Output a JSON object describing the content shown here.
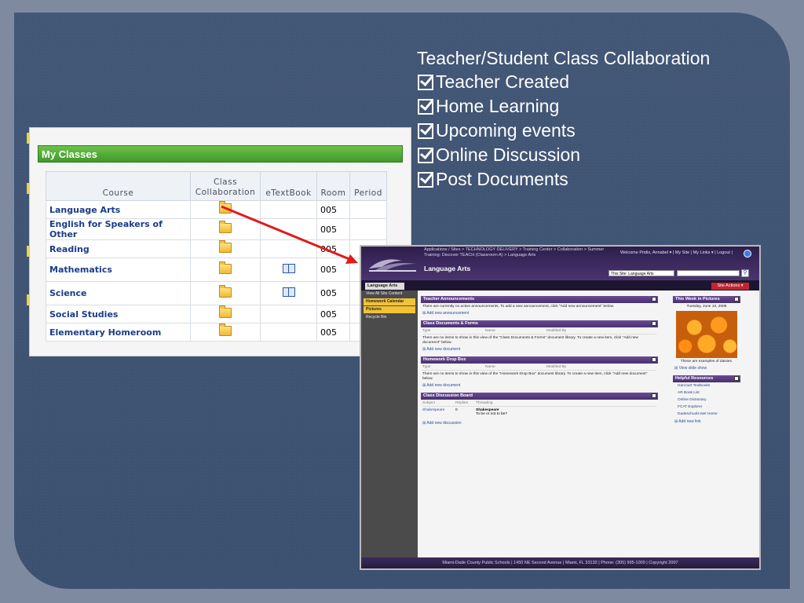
{
  "features": {
    "title": "Teacher/Student Class Collaboration",
    "items": [
      "Teacher Created",
      "Home Learning",
      "Upcoming events",
      "Online Discussion",
      "Post Documents"
    ]
  },
  "my_classes": {
    "title": "My Classes",
    "columns": [
      "Course",
      "Class Collaboration",
      "eTextBook",
      "Room",
      "Period"
    ],
    "rows": [
      {
        "course": "Language Arts",
        "room": "005"
      },
      {
        "course": "English for Speakers of Other",
        "room": "005"
      },
      {
        "course": "Reading",
        "room": "005"
      },
      {
        "course": "Mathematics",
        "room": "005"
      },
      {
        "course": "Science",
        "room": "005"
      },
      {
        "course": "Social Studies",
        "room": "005"
      },
      {
        "course": "Elementary Homeroom",
        "room": "005"
      }
    ]
  },
  "sharepoint": {
    "breadcrumb": "Applications / Sites > TECHNOLOGY DELIVERY > Training Center > Collaboration > Summer Training: Discover TEACH (Classroom A) > Language Arts",
    "site_title": "Language Arts",
    "welcome": "Welcome Pridis, Annabel ▾ | My Site | My Links ▾ | Logout |",
    "scope": "This Site: Language Arts",
    "tab": "Language Arts",
    "site_actions": "Site Actions ▾",
    "left_nav": [
      "View All Site Content",
      "Homework Calendar",
      "Pictures",
      "Recycle Bin"
    ],
    "announcements": {
      "title": "Teacher Announcements",
      "text": "There are currently no active announcements. To add a new announcement, click \"Add new announcement\" below.",
      "link": "⊞ Add new announcement"
    },
    "documents": {
      "title": "Class Documents & Forms",
      "cols": [
        "Type",
        "Name",
        "Modified By"
      ],
      "text": "There are no items to show in this view of the \"Class Documents & Forms\" document library. To create a new item, click \"Add new document\" below.",
      "link": "⊞ Add new document"
    },
    "dropbox": {
      "title": "Homework Drop Box",
      "cols": [
        "Type",
        "Name",
        "Modified By"
      ],
      "text": "There are no items to show in this view of the \"Homework Drop Box\" document library. To create a new item, click \"Add new document\" below.",
      "link": "⊞ Add new document"
    },
    "discussion": {
      "title": "Class Discussion Board",
      "cols": [
        "Subject",
        "Replies",
        "Threading"
      ],
      "subject": "Shakespeare",
      "replies": "0",
      "thread_title": "Shakespeare",
      "thread_text": "To be or not to be?",
      "link": "⊞ Add new discussion"
    },
    "pictures": {
      "title": "This Week in Pictures",
      "date": "Tuesday, June 10, 2008",
      "caption": "These are examples of daisies.",
      "link": "⊞ View slide show"
    },
    "resources": {
      "title": "Helpful Resources",
      "items": [
        "Harcourt Textbooks",
        "AR Book List",
        "Online Dictionary",
        "FCAT Explorer",
        "Dadeschools.Net Home"
      ],
      "link": "⊞ Add new link"
    },
    "footer": "Miami-Dade County Public Schools | 1450 NE Second Avenue | Miami, FL 33132 | Phone: (305) 995-1000 | Copyright 2007"
  }
}
